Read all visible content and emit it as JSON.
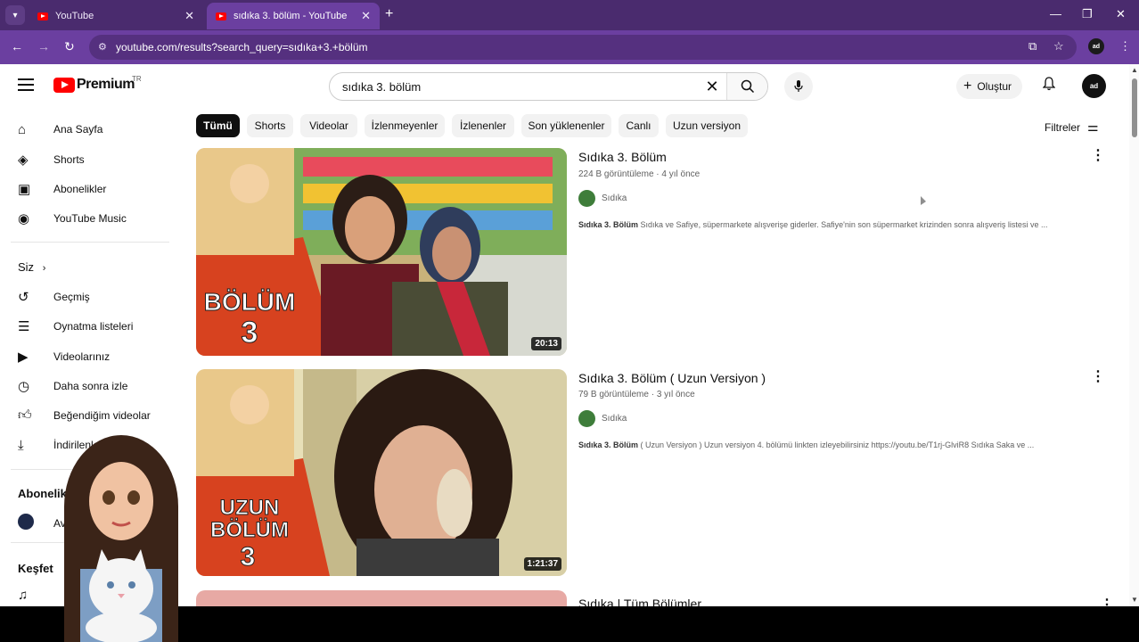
{
  "browser": {
    "tabs": [
      {
        "title": "YouTube",
        "close": "✕"
      },
      {
        "title": "sıdıka 3. bölüm - YouTube",
        "close": "✕"
      }
    ],
    "new_tab": "+",
    "url": "youtube.com/results?search_query=sıdıka+3.+bölüm",
    "profile_initials": "ad"
  },
  "header": {
    "logo_text": "Premium",
    "logo_region": "TR",
    "search_value": "sıdıka 3. bölüm",
    "create_label": "Oluştur",
    "avatar_initials": "ad"
  },
  "sidebar": {
    "items": [
      {
        "label": "Ana Sayfa",
        "icon": "home-icon"
      },
      {
        "label": "Shorts",
        "icon": "shorts-icon"
      },
      {
        "label": "Abonelikler",
        "icon": "subscriptions-icon"
      },
      {
        "label": "YouTube Music",
        "icon": "music-icon"
      }
    ],
    "you_label": "Siz",
    "you_items": [
      {
        "label": "Geçmiş",
        "icon": "history-icon"
      },
      {
        "label": "Oynatma listeleri",
        "icon": "playlist-icon"
      },
      {
        "label": "Videolarınız",
        "icon": "your-videos-icon"
      },
      {
        "label": "Daha sonra izle",
        "icon": "watch-later-icon"
      },
      {
        "label": "Beğendiğim videolar",
        "icon": "liked-icon"
      },
      {
        "label": "İndirilenler",
        "icon": "download-icon"
      }
    ],
    "subscriptions_label": "Abonelikler",
    "subscription_partial": "Av",
    "explore_label": "Keşfet"
  },
  "chips": [
    "Tümü",
    "Shorts",
    "Videolar",
    "İzlenmeyenler",
    "İzlenenler",
    "Son yüklenenler",
    "Canlı",
    "Uzun versiyon"
  ],
  "filters_label": "Filtreler",
  "results": [
    {
      "title": "Sıdıka 3. Bölüm",
      "meta": "224 B görüntüleme · 4 yıl önce",
      "channel": "Sıdıka",
      "desc_bold": "Sıdıka 3. Bölüm",
      "desc": " Sıdıka ve Safiye, süpermarkete alışverişe giderler. Safiye'nin son süpermarket krizinden sonra alışveriş listesi ve ...",
      "duration": "20:13",
      "thumb_text": [
        "BÖLÜM",
        "3"
      ]
    },
    {
      "title": "Sıdıka 3. Bölüm ( Uzun Versiyon )",
      "meta": "79 B görüntüleme · 3 yıl önce",
      "channel": "Sıdıka",
      "desc_bold": "Sıdıka 3. Bölüm",
      "desc": " ( Uzun Versiyon ) Uzun versiyon 4. bölümü linkten izleyebilirsiniz https://youtu.be/T1rj-GlviR8 Sıdıka Saka ve ...",
      "duration": "1:21:37",
      "thumb_text": [
        "UZUN",
        "BÖLÜM",
        "3"
      ]
    },
    {
      "title": "Sıdıka | Tüm Bölümler"
    }
  ]
}
